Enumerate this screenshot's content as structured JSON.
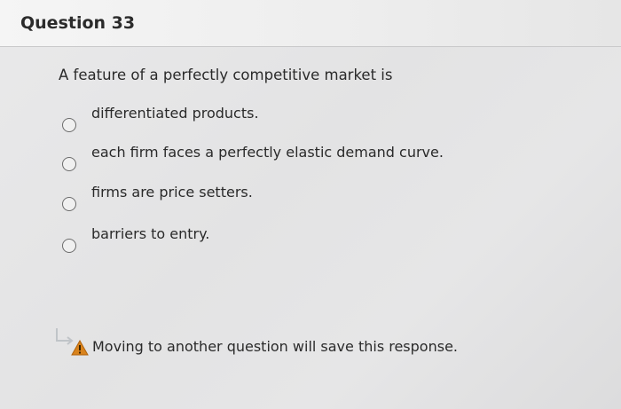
{
  "question": {
    "title": "Question 33",
    "prompt": "A feature of a perfectly competitive market is"
  },
  "options": [
    {
      "label": "differentiated products.",
      "selected": false
    },
    {
      "label": "each firm faces a perfectly elastic demand curve.",
      "selected": false
    },
    {
      "label": "firms are price setters.",
      "selected": false
    },
    {
      "label": "barriers to entry.",
      "selected": false
    }
  ],
  "footer": {
    "icon": "warning-icon",
    "message": "Moving to another question will save this response."
  },
  "colors": {
    "warning": "#d9831c",
    "arrow": "#c0c4c8"
  }
}
